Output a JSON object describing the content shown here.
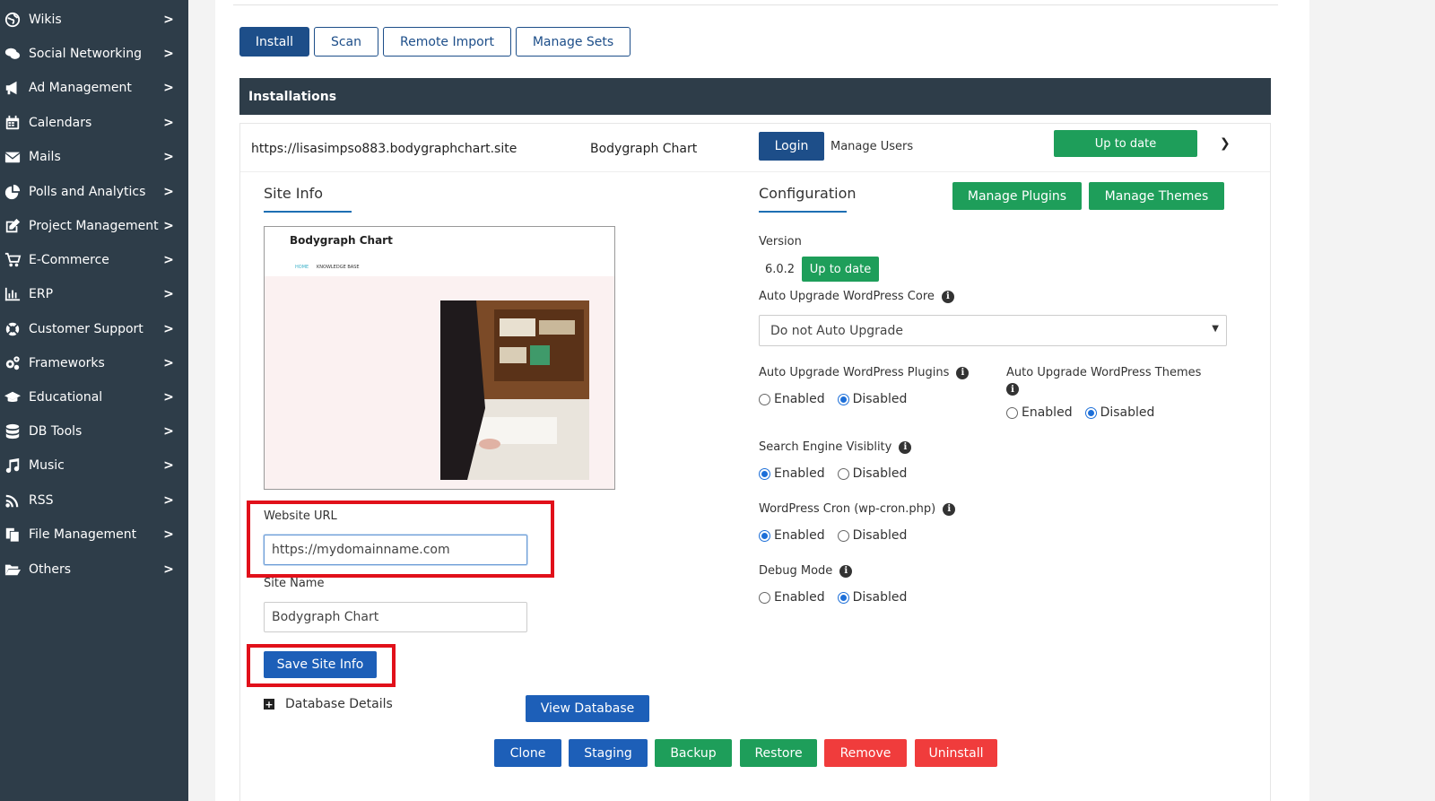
{
  "sidebar": {
    "items": [
      {
        "label": "Wikis",
        "icon": "globe-icon"
      },
      {
        "label": "Social Networking",
        "icon": "chat-icon"
      },
      {
        "label": "Ad Management",
        "icon": "megaphone-icon"
      },
      {
        "label": "Calendars",
        "icon": "calendar-icon"
      },
      {
        "label": "Mails",
        "icon": "envelope-icon"
      },
      {
        "label": "Polls and Analytics",
        "icon": "pie-chart-icon"
      },
      {
        "label": "Project Management",
        "icon": "edit-icon"
      },
      {
        "label": "E-Commerce",
        "icon": "cart-icon"
      },
      {
        "label": "ERP",
        "icon": "bar-chart-icon"
      },
      {
        "label": "Customer Support",
        "icon": "lifebuoy-icon"
      },
      {
        "label": "Frameworks",
        "icon": "gears-icon"
      },
      {
        "label": "Educational",
        "icon": "graduation-cap-icon"
      },
      {
        "label": "DB Tools",
        "icon": "database-icon"
      },
      {
        "label": "Music",
        "icon": "music-icon"
      },
      {
        "label": "RSS",
        "icon": "rss-icon"
      },
      {
        "label": "File Management",
        "icon": "files-icon"
      },
      {
        "label": "Others",
        "icon": "folder-open-icon"
      }
    ],
    "chevron": ">"
  },
  "tabs": {
    "install": "Install",
    "scan": "Scan",
    "remote_import": "Remote Import",
    "manage_sets": "Manage Sets"
  },
  "installations": {
    "header": "Installations",
    "url": "https://lisasimpso883.bodygraphchart.site",
    "title": "Bodygraph Chart",
    "login": "Login",
    "manage_users": "Manage Users",
    "status": "Up to date"
  },
  "site_info": {
    "heading": "Site Info",
    "preview_title": "Bodygraph Chart",
    "preview_nav_home": "HOME",
    "preview_nav_kb": "KNOWLEDGE BASE",
    "website_url_label": "Website URL",
    "website_url_value": "https://mydomainname.com",
    "site_name_label": "Site Name",
    "site_name_value": "Bodygraph Chart",
    "save_button": "Save Site Info",
    "database_details": "Database Details",
    "view_database": "View Database"
  },
  "configuration": {
    "heading": "Configuration",
    "manage_plugins": "Manage Plugins",
    "manage_themes": "Manage Themes",
    "version_label": "Version",
    "version_value": "6.0.2",
    "version_status": "Up to date",
    "auto_upgrade_core_label": "Auto Upgrade WordPress Core",
    "auto_upgrade_core_value": "Do not Auto Upgrade",
    "auto_upgrade_plugins_label": "Auto Upgrade WordPress Plugins",
    "auto_upgrade_themes_label": "Auto Upgrade WordPress Themes",
    "search_engine_label": "Search Engine Visiblity",
    "cron_label": "WordPress Cron (wp-cron.php)",
    "debug_label": "Debug Mode",
    "enabled": "Enabled",
    "disabled": "Disabled",
    "plugins_selected": "Disabled",
    "themes_selected": "Disabled",
    "search_engine_selected": "Enabled",
    "cron_selected": "Enabled",
    "debug_selected": "Disabled"
  },
  "actions": {
    "clone": "Clone",
    "staging": "Staging",
    "backup": "Backup",
    "restore": "Restore",
    "remove": "Remove",
    "uninstall": "Uninstall"
  },
  "colors": {
    "primary": "#1d4e89",
    "success": "#1e9e5a",
    "danger": "#f03c3c",
    "highlight": "#e1101a",
    "sidebar": "#2e3d49"
  }
}
